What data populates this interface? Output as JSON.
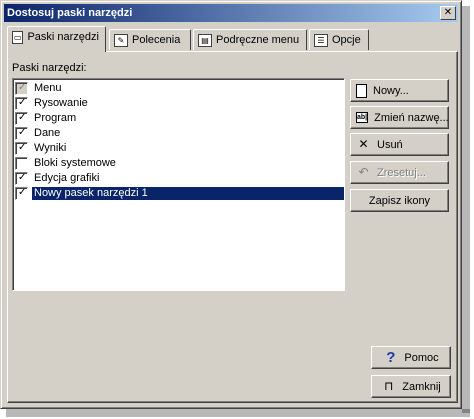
{
  "window": {
    "title": "Dostosuj paski narzędzi",
    "close_glyph": "✕"
  },
  "tabs": [
    {
      "label": "Paski narzędzi",
      "active": true,
      "icon": "toolbar-icon"
    },
    {
      "label": "Polecenia",
      "active": false,
      "icon": "commands-icon"
    },
    {
      "label": "Podręczne menu",
      "active": false,
      "icon": "context-menu-icon"
    },
    {
      "label": "Opcje",
      "active": false,
      "icon": "options-icon"
    }
  ],
  "toolbars_list": {
    "label": "Paski narzędzi:",
    "items": [
      {
        "label": "Menu",
        "checked": true,
        "disabled": true,
        "selected": false
      },
      {
        "label": "Rysowanie",
        "checked": true,
        "disabled": false,
        "selected": false
      },
      {
        "label": "Program",
        "checked": true,
        "disabled": false,
        "selected": false
      },
      {
        "label": "Dane",
        "checked": true,
        "disabled": false,
        "selected": false
      },
      {
        "label": "Wyniki",
        "checked": true,
        "disabled": false,
        "selected": false
      },
      {
        "label": "Bloki systemowe",
        "checked": false,
        "disabled": false,
        "selected": false
      },
      {
        "label": "Edycja grafiki",
        "checked": true,
        "disabled": false,
        "selected": false
      },
      {
        "label": "Nowy pasek narzędzi 1",
        "checked": true,
        "disabled": false,
        "selected": true
      }
    ]
  },
  "buttons": {
    "new": "Nowy...",
    "rename": "Zmień nazwę...",
    "delete": "Usuń",
    "reset": "Zresetuj...",
    "save_icons": "Zapisz ikony",
    "help": "Pomoc",
    "close": "Zamknij"
  },
  "icon_glyphs": {
    "help": "?",
    "delete": "✕",
    "reset": "↶",
    "rename": "ab|",
    "close": "⊓"
  },
  "colors": {
    "face": "#d4d0c8",
    "title_start": "#0a246a",
    "title_end": "#a6caf0",
    "selection": "#0a246a",
    "help_icon": "#1f3aa8"
  }
}
